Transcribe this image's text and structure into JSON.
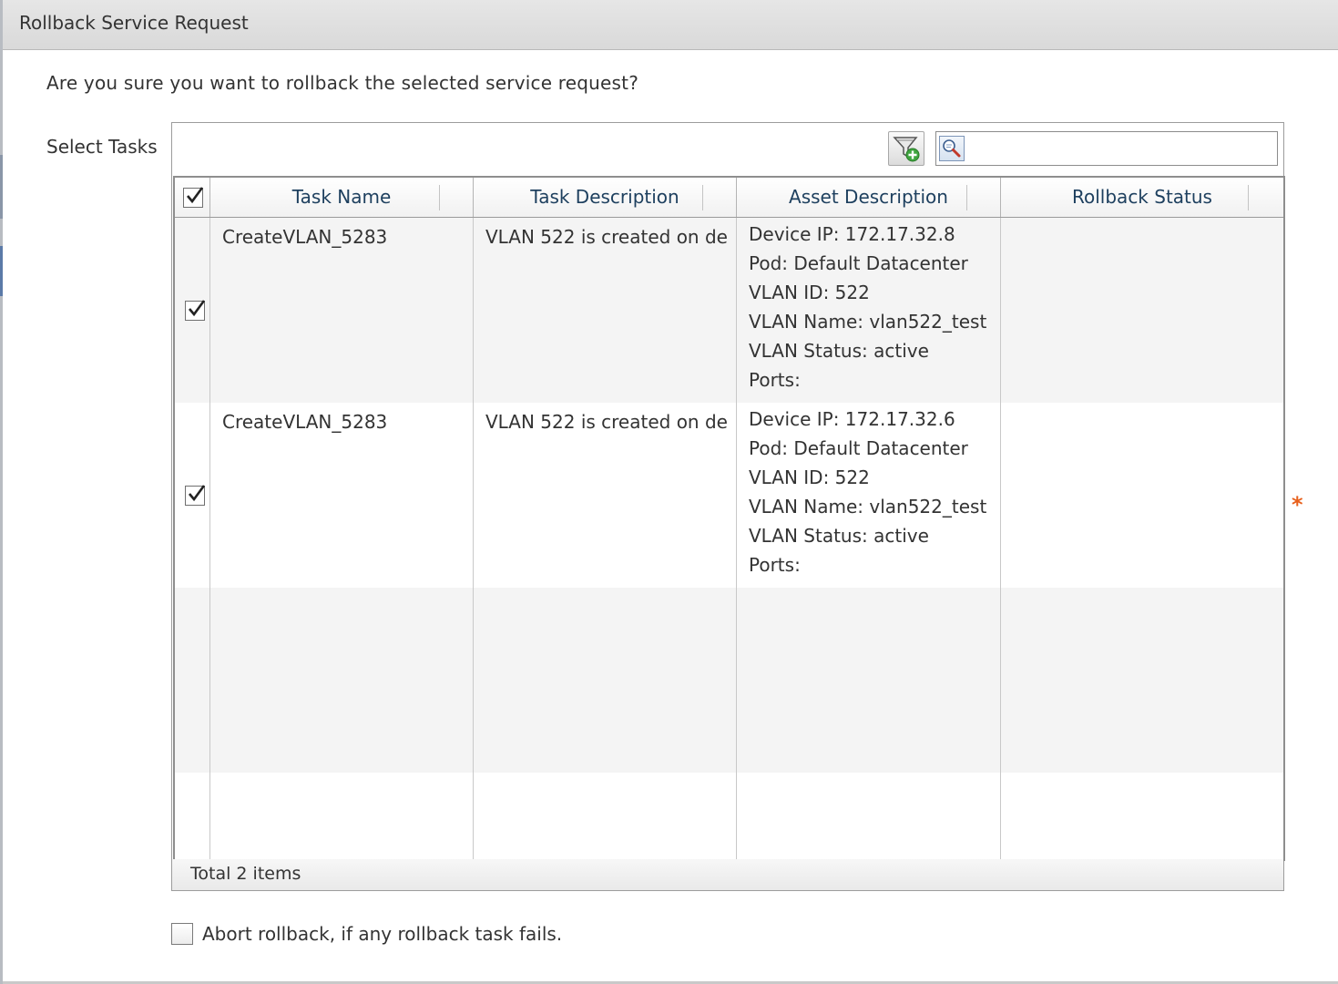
{
  "dialog": {
    "title": "Rollback Service Request",
    "question": "Are you sure you want to rollback the selected service request?",
    "select_tasks_label": "Select Tasks"
  },
  "toolbar": {
    "filter_icon": "filter-add-icon",
    "search_icon": "search-icon",
    "search_value": ""
  },
  "table": {
    "select_all_checked": true,
    "columns": [
      "Task Name",
      "Task Description",
      "Asset Description",
      "Rollback Status"
    ],
    "rows": [
      {
        "checked": true,
        "task_name": "CreateVLAN_5283",
        "task_description": "VLAN 522 is created on de",
        "asset_description": [
          "Device IP: 172.17.32.8",
          "Pod: Default Datacenter",
          "VLAN ID: 522",
          "VLAN Name: vlan522_test",
          "VLAN Status: active",
          "Ports:"
        ],
        "rollback_status": ""
      },
      {
        "checked": true,
        "task_name": "CreateVLAN_5283",
        "task_description": "VLAN 522 is created on de",
        "asset_description": [
          "Device IP: 172.17.32.6",
          "Pod: Default Datacenter",
          "VLAN ID: 522",
          "VLAN Name: vlan522_test",
          "VLAN Status: active",
          "Ports:"
        ],
        "rollback_status": ""
      }
    ],
    "footer": "Total 2 items"
  },
  "required_marker": "*",
  "abort_option": {
    "label": "Abort rollback, if any rollback task fails.",
    "checked": false
  },
  "colors": {
    "header_text": "#1d3f5e",
    "required": "#e8601c"
  }
}
